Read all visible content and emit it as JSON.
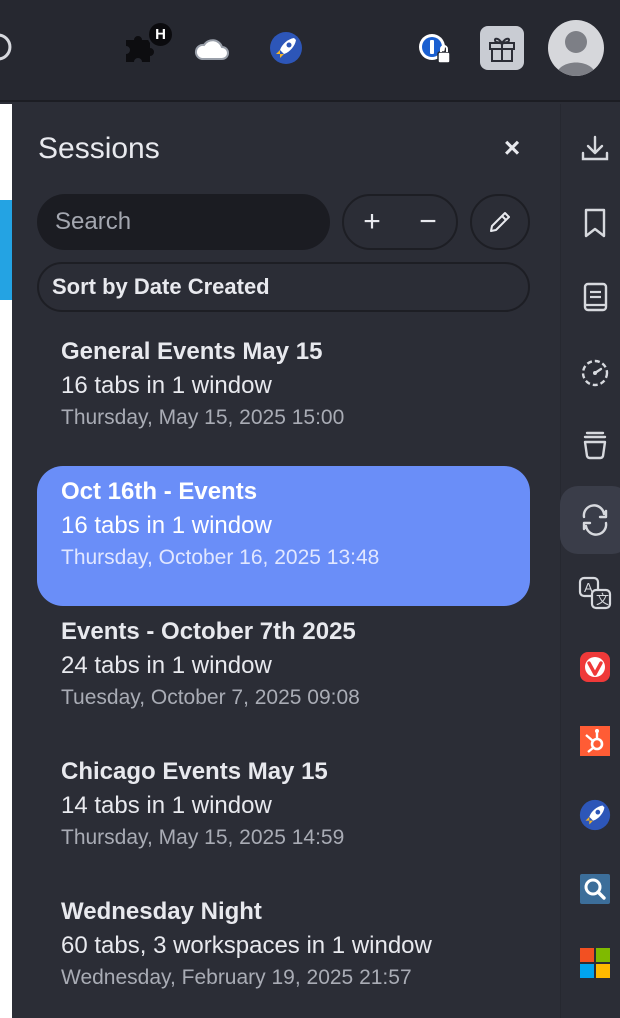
{
  "toolbar": {
    "icons": [
      "reload-icon",
      "extensions-puzzle-icon",
      "cloud-icon",
      "rocket-icon",
      "password-manager-icon",
      "gift-icon",
      "avatar"
    ],
    "extension_badge": "H"
  },
  "panel": {
    "title": "Sessions",
    "close_glyph": "×",
    "search_placeholder": "Search",
    "add_glyph": "+",
    "remove_glyph": "−",
    "sort_label": "Sort by Date Created"
  },
  "sessions": [
    {
      "name": "General Events May 15",
      "count": "16 tabs in 1 window",
      "date": "Thursday, May 15, 2025 15:00",
      "selected": false
    },
    {
      "name": "Oct 16th - Events",
      "count": "16 tabs in 1 window",
      "date": "Thursday, October 16, 2025 13:48",
      "selected": true
    },
    {
      "name": "Events - October 7th 2025",
      "count": "24 tabs in 1 window",
      "date": "Tuesday, October 7, 2025 09:08",
      "selected": false
    },
    {
      "name": "Chicago Events May 15",
      "count": "14 tabs in 1 window",
      "date": "Thursday, May 15, 2025 14:59",
      "selected": false
    },
    {
      "name": "Wednesday Night",
      "count": "60 tabs, 3 workspaces in 1 window",
      "date": "Wednesday, February 19, 2025 21:57",
      "selected": false
    }
  ],
  "sidebar": {
    "items": [
      "downloads-icon",
      "bookmarks-icon",
      "reading-list-icon",
      "history-icon",
      "notes-icon",
      "sessions-icon",
      "translate-icon",
      "vivaldi-icon",
      "hubspot-icon",
      "rocket-icon",
      "search-icon",
      "microsoft-icon"
    ],
    "active": "sessions-icon"
  },
  "colors": {
    "background": "#2b2d36",
    "selected_session": "#6a8ef8",
    "accent_blue": "#24a3e3",
    "vivaldi_red": "#ef3939",
    "hubspot_orange": "#ff5c35"
  }
}
